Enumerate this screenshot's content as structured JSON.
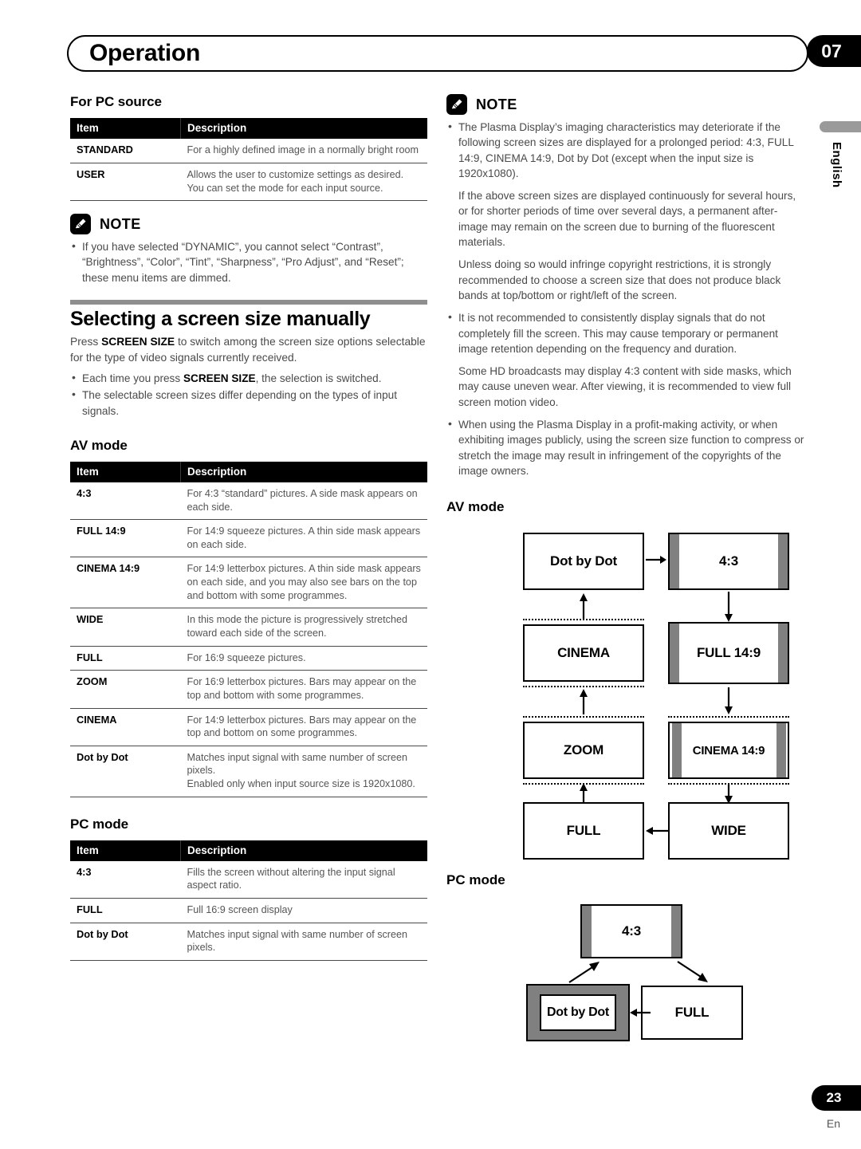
{
  "header": {
    "title": "Operation",
    "chapter": "07",
    "language": "English"
  },
  "footer": {
    "page_number": "23",
    "language_code": "En"
  },
  "left": {
    "pc_source": {
      "heading": "For PC source",
      "columns": [
        "Item",
        "Description"
      ],
      "rows": [
        {
          "item": "STANDARD",
          "desc": "For a highly defined image in a normally bright room"
        },
        {
          "item": "USER",
          "desc": "Allows the user to customize settings as desired. You can set the mode for each input source."
        }
      ]
    },
    "note1": {
      "label": "NOTE",
      "icon": "pencil-icon",
      "items": [
        "If you have selected “DYNAMIC”, you cannot select “Contrast”, “Brightness”, “Color”, “Tint”, “Sharpness”, “Pro Adjust”, and “Reset”; these menu items are dimmed."
      ]
    },
    "section": {
      "heading": "Selecting a screen size manually",
      "intro_a": "Press ",
      "intro_b": "SCREEN SIZE",
      "intro_c": " to switch among the screen size options selectable for the type of video signals currently received.",
      "bullet1_a": "Each time you press ",
      "bullet1_b": "SCREEN SIZE",
      "bullet1_c": ", the selection is switched.",
      "bullet2": "The selectable screen sizes differ depending on the types of input signals."
    },
    "av_mode": {
      "heading": "AV mode",
      "columns": [
        "Item",
        "Description"
      ],
      "rows": [
        {
          "item": "4:3",
          "desc": "For 4:3 “standard” pictures. A side mask appears on each side."
        },
        {
          "item": "FULL 14:9",
          "desc": "For 14:9 squeeze pictures. A thin side mask appears on each side."
        },
        {
          "item": "CINEMA 14:9",
          "desc": "For 14:9 letterbox pictures. A thin side mask appears on each side, and you may also see bars on the top and bottom with some programmes."
        },
        {
          "item": "WIDE",
          "desc": "In this mode the picture is progressively stretched toward each side of the screen."
        },
        {
          "item": "FULL",
          "desc": "For 16:9 squeeze pictures."
        },
        {
          "item": "ZOOM",
          "desc": "For 16:9 letterbox pictures. Bars may appear on the top and bottom with some programmes."
        },
        {
          "item": "CINEMA",
          "desc": "For 14:9 letterbox pictures. Bars may appear on the top and bottom on some programmes."
        },
        {
          "item": "Dot by Dot",
          "desc": "Matches input signal with same number of screen pixels.\nEnabled only when input source size is 1920x1080."
        }
      ]
    },
    "pc_mode": {
      "heading": "PC mode",
      "columns": [
        "Item",
        "Description"
      ],
      "rows": [
        {
          "item": "4:3",
          "desc": "Fills the screen without altering the input signal aspect ratio."
        },
        {
          "item": "FULL",
          "desc": "Full 16:9 screen display"
        },
        {
          "item": "Dot by Dot",
          "desc": "Matches input signal with same number of screen pixels."
        }
      ]
    }
  },
  "right": {
    "note2": {
      "label": "NOTE",
      "icon": "pencil-icon",
      "items": [
        {
          "bulleted": true,
          "text": "The Plasma Display’s imaging characteristics may deteriorate if the following screen sizes are displayed for a prolonged period: 4:3, FULL 14:9, CINEMA 14:9, Dot by Dot (except when the input size is 1920x1080)."
        },
        {
          "bulleted": false,
          "text": "If the above screen sizes are displayed continuously for several hours, or for shorter periods of time over several days, a permanent after-image may remain on the screen due to burning of the fluorescent materials."
        },
        {
          "bulleted": false,
          "text": "Unless doing so would infringe copyright restrictions, it is strongly recommended to choose a screen size that does not produce black bands at top/bottom or right/left of the screen."
        },
        {
          "bulleted": true,
          "text": "It is not recommended to consistently display signals that do not completely fill the screen. This may cause temporary or permanent image retention depending on the frequency and duration."
        },
        {
          "bulleted": false,
          "text": "Some HD broadcasts may display 4:3 content with side masks, which may cause uneven wear. After viewing, it is recommended to view full screen motion video."
        },
        {
          "bulleted": true,
          "text": "When using the Plasma Display in a profit-making activity, or when exhibiting images publicly, using the screen size function to compress or stretch the image may result in infringement of the copyrights of the image owners."
        }
      ]
    },
    "av_diagram": {
      "heading": "AV mode",
      "nodes": {
        "dot_by_dot": "Dot by Dot",
        "four_three": "4:3",
        "cinema": "CINEMA",
        "full_149": "FULL 14:9",
        "zoom": "ZOOM",
        "cinema_149": "CINEMA 14:9",
        "full": "FULL",
        "wide": "WIDE"
      }
    },
    "pc_diagram": {
      "heading": "PC mode",
      "nodes": {
        "four_three": "4:3",
        "full": "FULL",
        "dot_by_dot": "Dot by Dot"
      }
    }
  }
}
